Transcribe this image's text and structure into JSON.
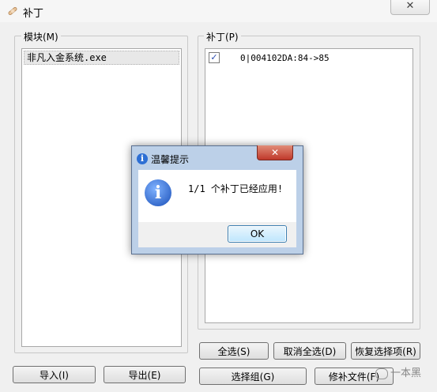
{
  "window": {
    "title": "补丁",
    "close_glyph": "✕",
    "icon": "bandage-icon"
  },
  "modules_group": {
    "legend": "模块(M)",
    "items": [
      "非凡入金系统.exe"
    ]
  },
  "patches_group": {
    "legend": "补丁(P)",
    "items": [
      {
        "checked": true,
        "check_glyph": "✓",
        "text": "0|004102DA:84->85"
      }
    ]
  },
  "buttons": {
    "import": "导入(I)",
    "export": "导出(E)",
    "select_all": "全选(S)",
    "deselect_all": "取消全选(D)",
    "restore_selection": "恢复选择项(R)",
    "select_group": "选择组(G)",
    "patch_file": "修补文件(F)"
  },
  "dialog": {
    "title": "温馨提示",
    "close_glyph": "✕",
    "info_glyph": "i",
    "message": "1/1 个补丁已经应用!",
    "ok": "OK",
    "icon": "info-icon"
  },
  "watermark": {
    "text": "一本黑"
  }
}
